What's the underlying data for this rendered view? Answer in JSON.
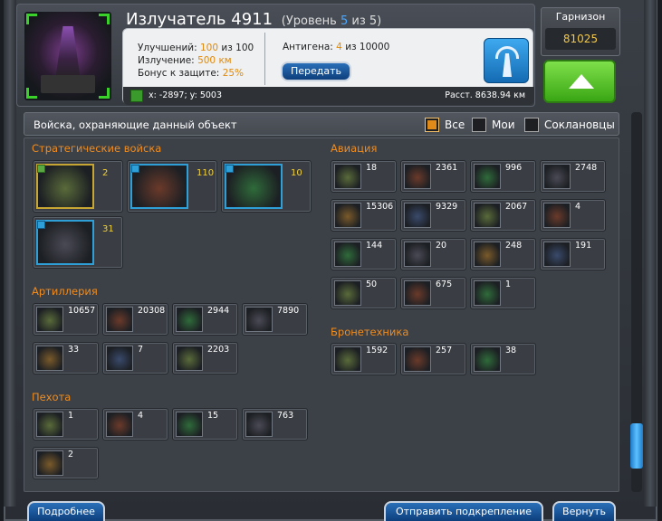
{
  "header": {
    "title": "Излучатель 4911",
    "level_prefix": "(Уровень ",
    "level_value": "5",
    "level_suffix": " из 5)",
    "upgrades_label": "Улучшений:",
    "upgrades_value": "100",
    "upgrades_of": "из 100",
    "radiation_label": "Излучение:",
    "radiation_value": "500 км",
    "defense_label": "Бонус к защите:",
    "defense_value": "25%",
    "antigen_label": "Антигена:",
    "antigen_value": "4",
    "antigen_of": "из 10000",
    "transfer_label": "Передать",
    "coords": "x: -2897; y: 5003",
    "distance": "Расст. 8638.94 км"
  },
  "garrison": {
    "label": "Гарнизон",
    "value": "81025"
  },
  "filter": {
    "caption": "Войска, охраняющие данный объект",
    "all_label": "Все",
    "mine_label": "Мои",
    "clan_label": "Соклановцы"
  },
  "sections": {
    "strategic": "Стратегические войска",
    "artillery": "Артиллерия",
    "infantry": "Пехота",
    "aviation": "Авиация",
    "armor": "Бронетехника"
  },
  "strategic_units": [
    "2",
    "110",
    "10",
    "31"
  ],
  "artillery_units": [
    "10657",
    "20308",
    "2944",
    "7890",
    "33",
    "7",
    "2203"
  ],
  "infantry_units": [
    "1",
    "4",
    "15",
    "763",
    "2"
  ],
  "aviation_units": [
    "18",
    "2361",
    "996",
    "2748",
    "15306",
    "9329",
    "2067",
    "4",
    "144",
    "20",
    "248",
    "191",
    "50",
    "675",
    "1"
  ],
  "armor_units": [
    "1592",
    "257",
    "38"
  ],
  "bottom": {
    "left": "Подробнее",
    "center": "Отправить подкрепление",
    "right": "Вернуть"
  },
  "colors": {
    "accent": "#f08c1e",
    "value": "#e08a0e",
    "green": "#3aa614",
    "blue": "#146bb3"
  }
}
